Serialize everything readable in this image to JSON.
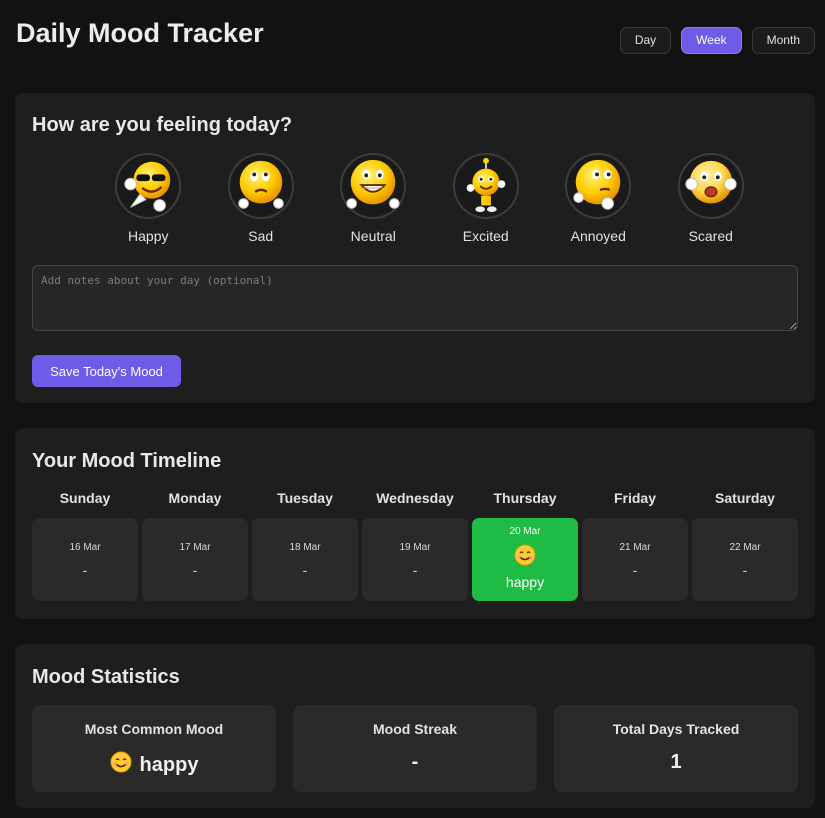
{
  "header": {
    "title": "Daily Mood Tracker"
  },
  "view_toggle": [
    {
      "label": "Day",
      "active": false
    },
    {
      "label": "Week",
      "active": true
    },
    {
      "label": "Month",
      "active": false
    }
  ],
  "mood_picker": {
    "title": "How are you feeling today?",
    "options": [
      {
        "label": "Happy",
        "icon": "cool-sunglasses-emoji-icon"
      },
      {
        "label": "Sad",
        "icon": "sad-emoji-icon"
      },
      {
        "label": "Neutral",
        "icon": "grinning-emoji-icon"
      },
      {
        "label": "Excited",
        "icon": "excited-emoji-icon"
      },
      {
        "label": "Annoyed",
        "icon": "annoyed-emoji-icon"
      },
      {
        "label": "Scared",
        "icon": "scared-emoji-icon"
      }
    ],
    "notes_placeholder": "Add notes about your day (optional)",
    "notes_value": "",
    "save_label": "Save Today's Mood"
  },
  "timeline": {
    "title": "Your Mood Timeline",
    "days": [
      {
        "name": "Sunday",
        "date": "16 Mar",
        "mood": "-"
      },
      {
        "name": "Monday",
        "date": "17 Mar",
        "mood": "-"
      },
      {
        "name": "Tuesday",
        "date": "18 Mar",
        "mood": "-"
      },
      {
        "name": "Wednesday",
        "date": "19 Mar",
        "mood": "-"
      },
      {
        "name": "Thursday",
        "date": "20 Mar",
        "mood": "happy",
        "emoji": "😊",
        "logged": true
      },
      {
        "name": "Friday",
        "date": "21 Mar",
        "mood": "-"
      },
      {
        "name": "Saturday",
        "date": "22 Mar",
        "mood": "-"
      }
    ],
    "logged_color": "#1ebb45"
  },
  "stats": {
    "title": "Mood Statistics",
    "most_common": {
      "label": "Most Common Mood",
      "emoji": "😊",
      "value": "happy"
    },
    "streak": {
      "label": "Mood Streak",
      "value": "-"
    },
    "total": {
      "label": "Total Days Tracked",
      "value": "1"
    }
  },
  "colors": {
    "accent": "#6c5ce7",
    "background": "#121212",
    "card": "#1e1e1e"
  }
}
